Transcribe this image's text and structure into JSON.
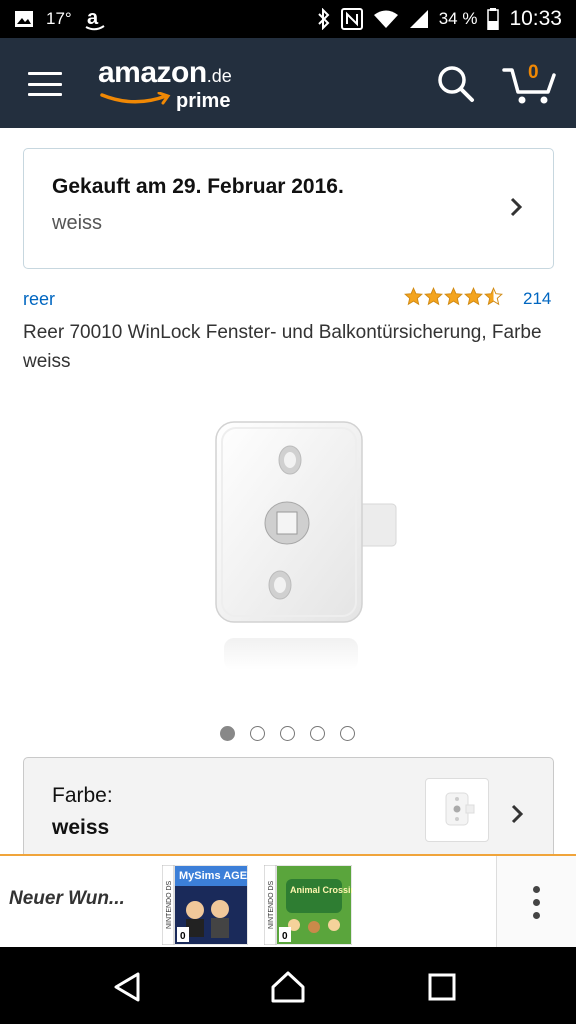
{
  "status_bar": {
    "temperature": "17°",
    "battery": "34 %",
    "time": "10:33"
  },
  "app_bar": {
    "logo_text": "amazon",
    "logo_tld": ".de",
    "logo_sub": "prime",
    "cart_count": "0",
    "accent_color": "#f08804",
    "background_color": "#232f3e"
  },
  "purchase": {
    "title": "Gekauft am 29. Februar 2016.",
    "variant": "weiss"
  },
  "product": {
    "brand": "reer",
    "rating": 4.5,
    "rating_max": 5,
    "review_count": "214",
    "title": "Reer 70010 WinLock Fenster- und Balkontürsicherung, Farbe weiss",
    "image_count": 5,
    "active_image": 1
  },
  "variant_selector": {
    "label": "Farbe:",
    "value": "weiss"
  },
  "ad_banner": {
    "text": "Neuer Wun...",
    "game1_title": "MySims AGENTS",
    "game2_title": "Animal Crossing",
    "age_rating": "0"
  }
}
